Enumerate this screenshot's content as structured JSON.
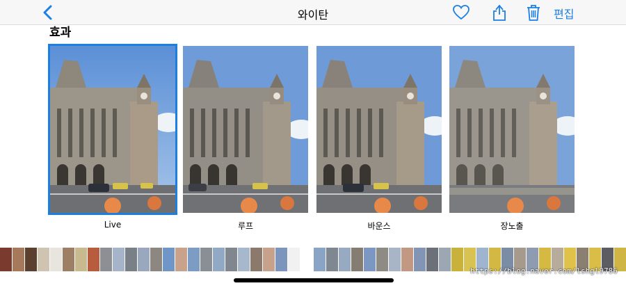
{
  "nav": {
    "title": "와이탄",
    "edit_label": "편집",
    "icons": [
      "chevron-left-icon",
      "heart-icon",
      "share-icon",
      "trash-icon"
    ],
    "accent_color": "#1a7fe4"
  },
  "section": {
    "title": "효과"
  },
  "effects": [
    {
      "label": "Live",
      "selected": true
    },
    {
      "label": "루프",
      "selected": false
    },
    {
      "label": "바운스",
      "selected": false
    },
    {
      "label": "장노출",
      "selected": false
    }
  ],
  "watermark": "https://blog.naver.com/lshgl9786"
}
